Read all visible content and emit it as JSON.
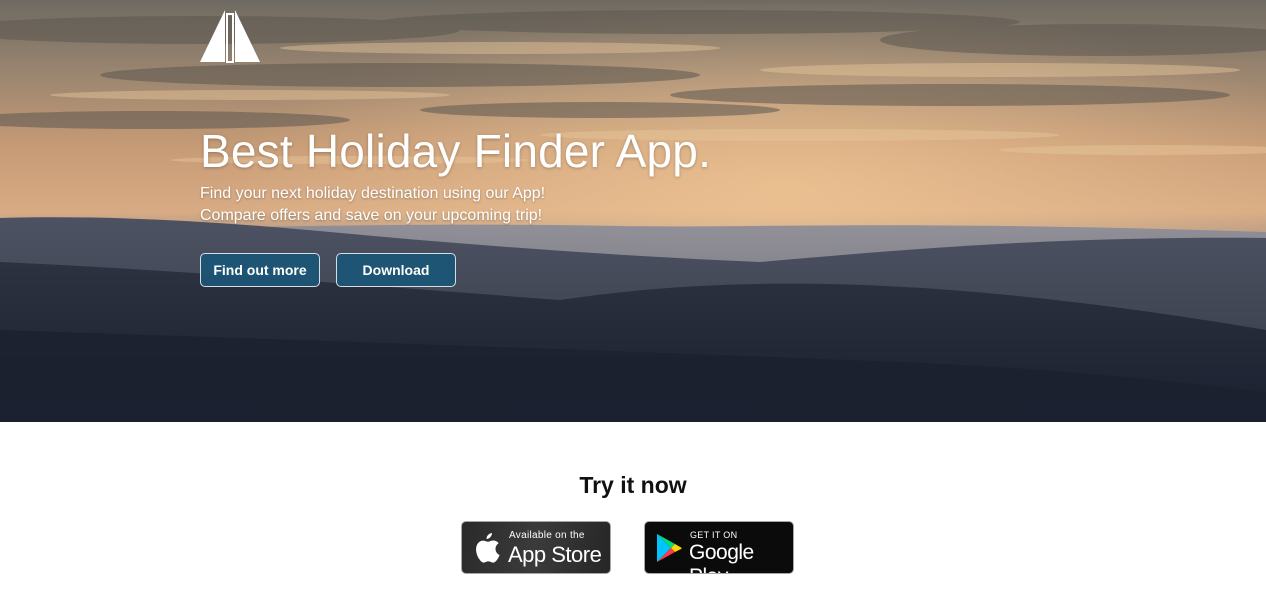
{
  "hero": {
    "logo_icon": "sail-logo-icon",
    "title": "Best Holiday Finder App.",
    "subtitle_line1": "Find your next holiday destination using our App!",
    "subtitle_line2": "Compare offers and save on your upcoming trip!",
    "buttons": {
      "find_out_more": "Find out more",
      "download": "Download"
    },
    "colors": {
      "button_bg": "#1c5676",
      "text": "#ffffff"
    }
  },
  "cta": {
    "heading": "Try it now",
    "app_store": {
      "small": "Available on the",
      "big": "App Store",
      "icon": "apple-icon"
    },
    "google_play": {
      "small": "GET IT ON",
      "big": "Google Play",
      "icon": "google-play-icon"
    }
  }
}
